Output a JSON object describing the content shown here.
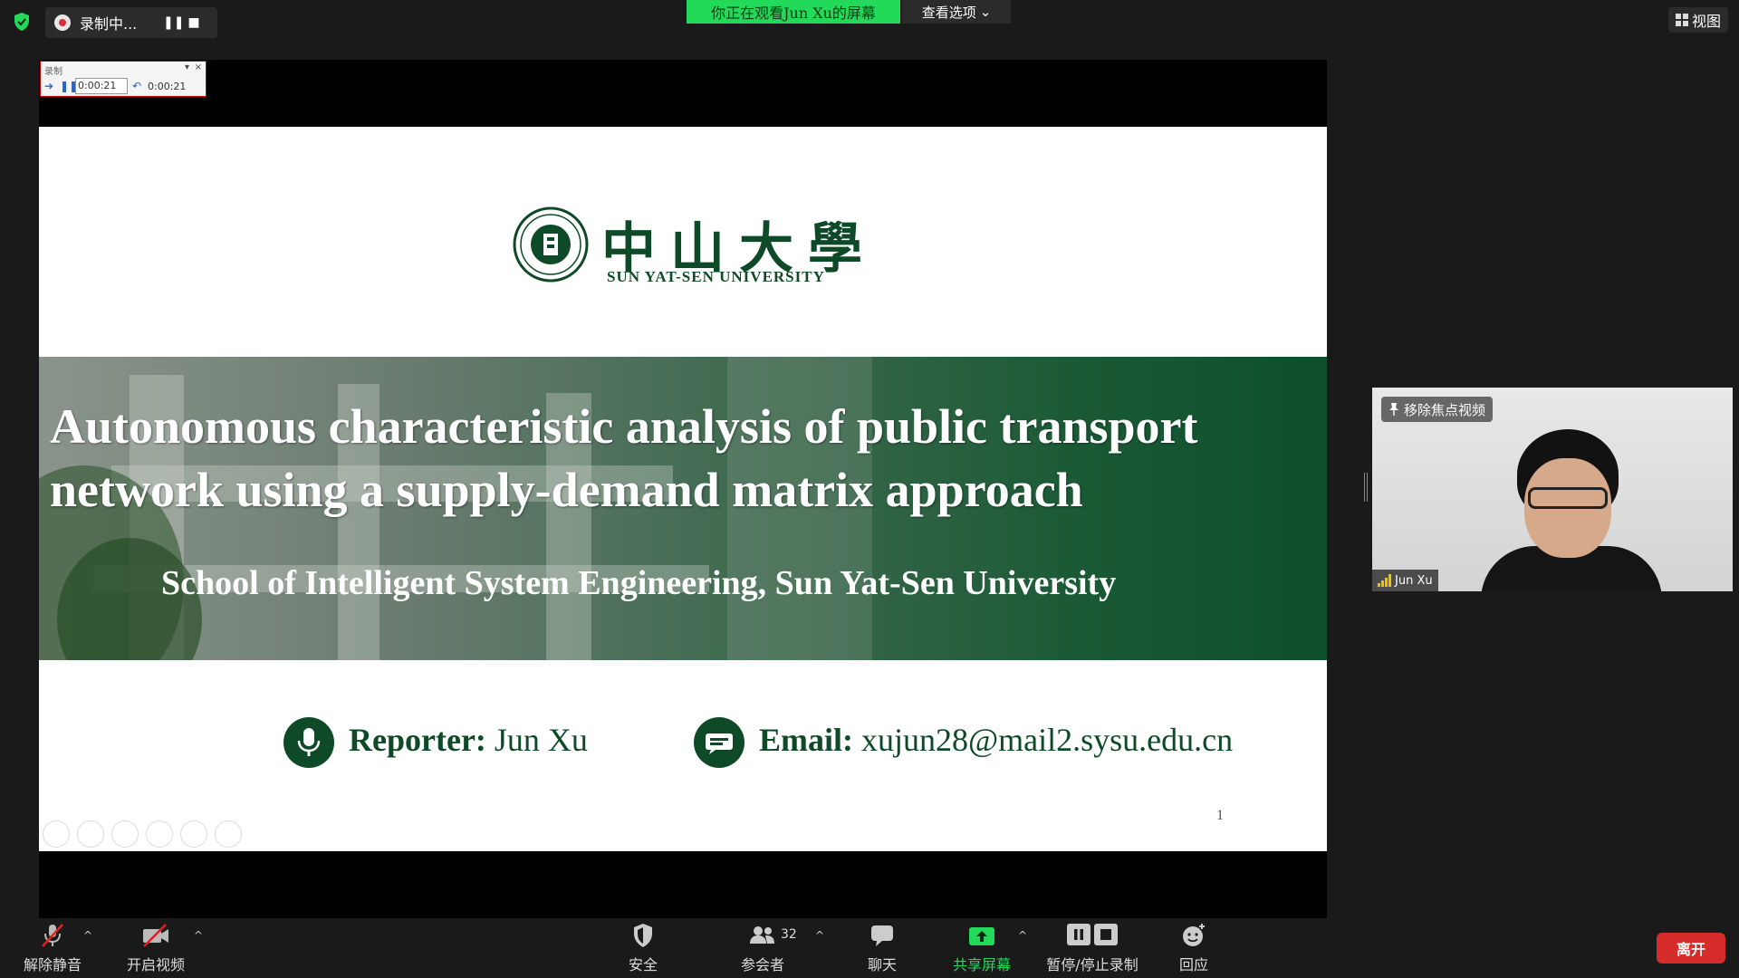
{
  "topbar": {
    "recording_label": "录制中...",
    "pause_glyph": "❚❚",
    "stop_glyph": "■",
    "viewing_banner": "你正在观看Jun Xu的屏幕",
    "view_options": "查看选项",
    "view_options_caret": "⌄",
    "view_button": "视图"
  },
  "recorder_widget": {
    "label": "录制",
    "time_field": "0:00:21",
    "elapsed": "0:00:21",
    "close_glyph": "×",
    "dropdown_glyph": "▾"
  },
  "slide": {
    "logo_cn": "中山大學",
    "logo_en": "SUN  YAT-SEN UNIVERSITY",
    "title_line1": "Autonomous characteristic analysis of public transport",
    "title_line2": "network using a supply-demand matrix approach",
    "subtitle": "School of Intelligent System Engineering, Sun Yat-Sen University",
    "reporter_label": "Reporter:",
    "reporter_name": " Jun Xu",
    "email_label": "Email:",
    "email_value": " xujun28@mail2.sysu.edu.cn",
    "page_number": "1"
  },
  "video": {
    "unpin_label": "移除焦点视频",
    "participant_name": "Jun Xu"
  },
  "toolbar": {
    "unmute": "解除静音",
    "start_video": "开启视频",
    "security": "安全",
    "participants": "参会者",
    "participant_count": "32",
    "chat": "聊天",
    "share_screen": "共享屏幕",
    "pause_stop_recording": "暂停/停止录制",
    "reactions": "回应",
    "leave": "离开",
    "caret": "^"
  },
  "colors": {
    "accent_green": "#23d959",
    "sysu_green": "#0f4a28",
    "leave_red": "#d72c2c"
  }
}
